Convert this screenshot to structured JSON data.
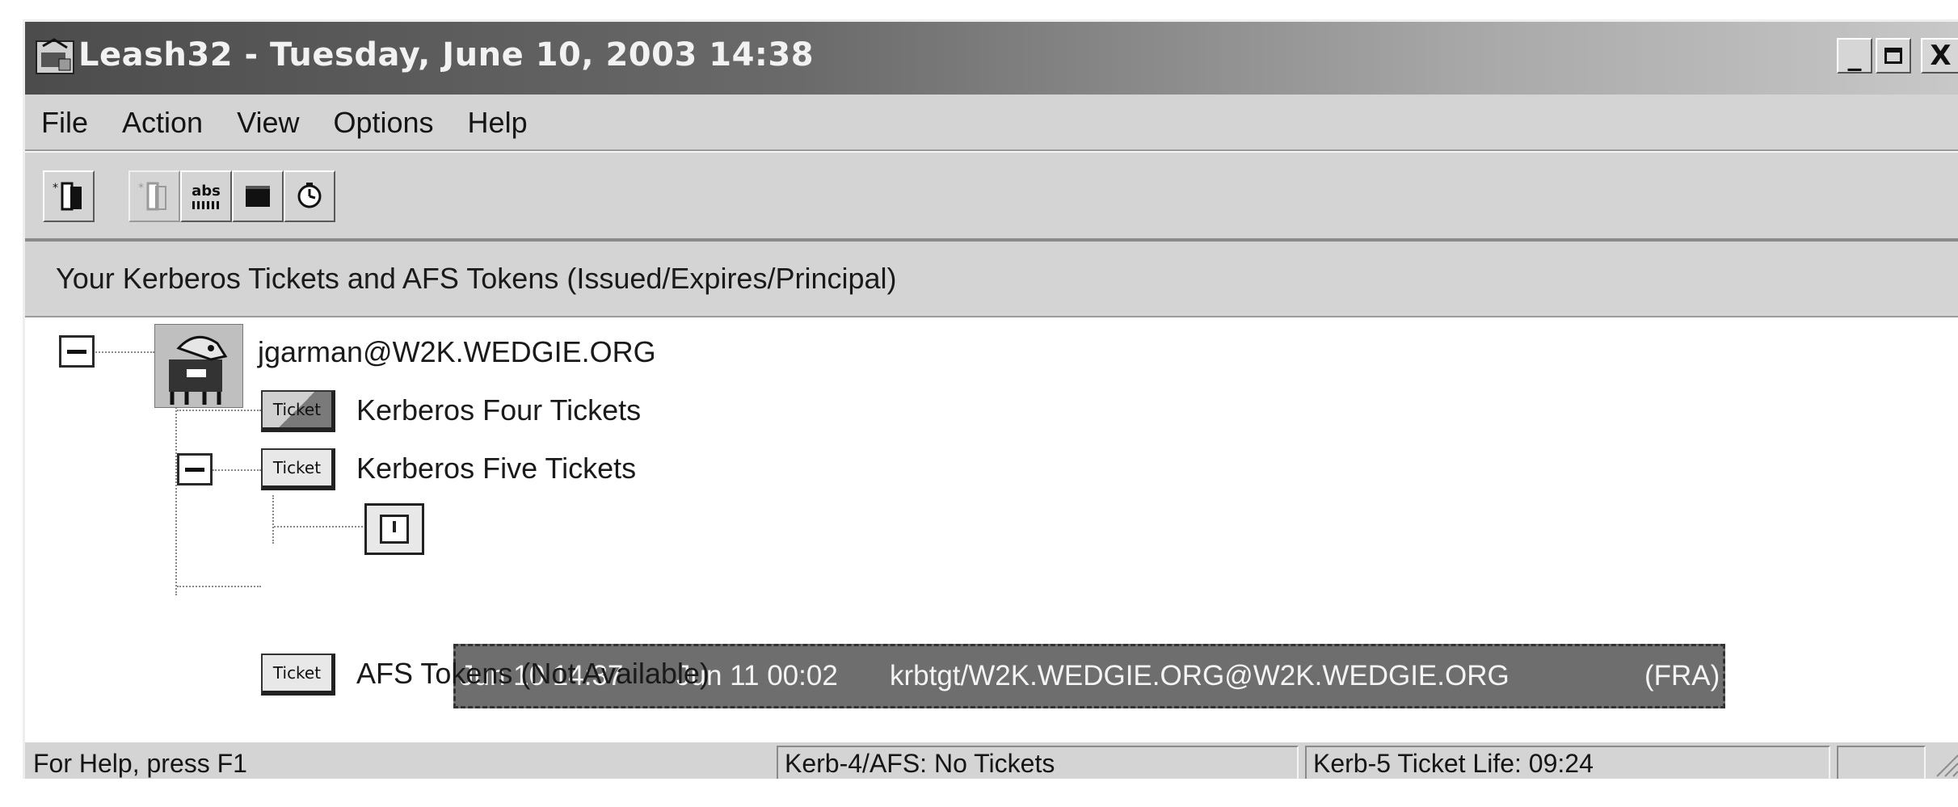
{
  "window": {
    "title": "Leash32 - Tuesday, June 10, 2003  14:38",
    "controls": {
      "minimize": "_",
      "maximize": "□",
      "close": "X"
    },
    "icon": "leash-app-icon"
  },
  "menu": [
    "File",
    "Action",
    "View",
    "Options",
    "Help"
  ],
  "toolbar": {
    "buttons": [
      {
        "name": "get-tickets",
        "icon": "ticket-new-icon",
        "enabled": true
      },
      {
        "name": "renew-tickets",
        "icon": "ticket-renew-icon",
        "enabled": false
      },
      {
        "name": "change-password",
        "icon": "abc-password-icon",
        "label": "abs",
        "enabled": true
      },
      {
        "name": "destroy-tickets",
        "icon": "black-square-icon",
        "enabled": true
      },
      {
        "name": "sync-time",
        "icon": "clock-icon",
        "enabled": true
      }
    ]
  },
  "panel": {
    "header": "Your Kerberos Tickets and AFS Tokens (Issued/Expires/Principal)"
  },
  "tree": {
    "principal": "jgarman@W2K.WEDGIE.ORG",
    "krb4": {
      "label": "Kerberos Four Tickets",
      "icon_text": "Ticket"
    },
    "krb5": {
      "label": "Kerberos Five Tickets",
      "icon_text": "Ticket"
    },
    "ticket": {
      "issued": "Jun 10 14:37",
      "expires": "Jun 11 00:02",
      "principal": "krbtgt/W2K.WEDGIE.ORG@W2K.WEDGIE.ORG",
      "flags": "(FRA)"
    },
    "afs": {
      "label": "AFS Tokens (Not Available)",
      "icon_text": "Ticket"
    }
  },
  "status": {
    "help": "For Help, press F1",
    "krb4": "Kerb-4/AFS: No Tickets",
    "krb5": "Kerb-5 Ticket Life: 09:24"
  }
}
